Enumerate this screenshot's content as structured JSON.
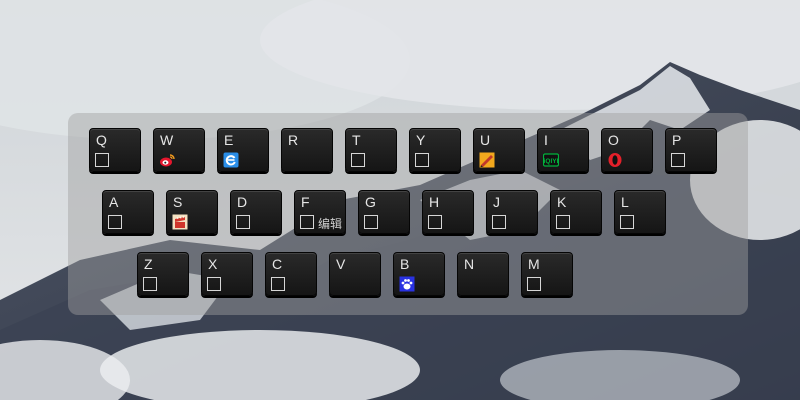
{
  "rows": [
    [
      "Q",
      "W",
      "E",
      "R",
      "T",
      "Y",
      "U",
      "I",
      "O",
      "P"
    ],
    [
      "A",
      "S",
      "D",
      "F",
      "G",
      "H",
      "J",
      "K",
      "L"
    ],
    [
      "Z",
      "X",
      "C",
      "V",
      "B",
      "N",
      "M"
    ]
  ],
  "keys": {
    "Q": {
      "icon": null
    },
    "W": {
      "icon": "weibo-icon",
      "color": "#e6162d"
    },
    "E": {
      "icon": "browser-e-icon",
      "color": "#2a8ee8"
    },
    "R": {
      "icon": "none"
    },
    "T": {
      "icon": null
    },
    "Y": {
      "icon": null
    },
    "U": {
      "icon": "pen-app-icon",
      "color": "#f2a81d"
    },
    "I": {
      "icon": "iqiyi-icon",
      "color": "#00b33c",
      "text": "iQIYI"
    },
    "O": {
      "icon": "opera-icon",
      "color": "#e4202a"
    },
    "P": {
      "icon": null
    },
    "A": {
      "icon": null
    },
    "S": {
      "icon": "media-app-icon",
      "color": "#e8c28a"
    },
    "D": {
      "icon": null
    },
    "F": {
      "icon": null,
      "edit": "编辑"
    },
    "G": {
      "icon": null
    },
    "H": {
      "icon": null
    },
    "J": {
      "icon": null
    },
    "K": {
      "icon": null
    },
    "L": {
      "icon": null
    },
    "Z": {
      "icon": null
    },
    "X": {
      "icon": null
    },
    "C": {
      "icon": null
    },
    "V": {
      "icon": "none"
    },
    "B": {
      "icon": "baidu-paw-icon",
      "color": "#2932e1"
    },
    "N": {
      "icon": "none"
    },
    "M": {
      "icon": null
    }
  }
}
